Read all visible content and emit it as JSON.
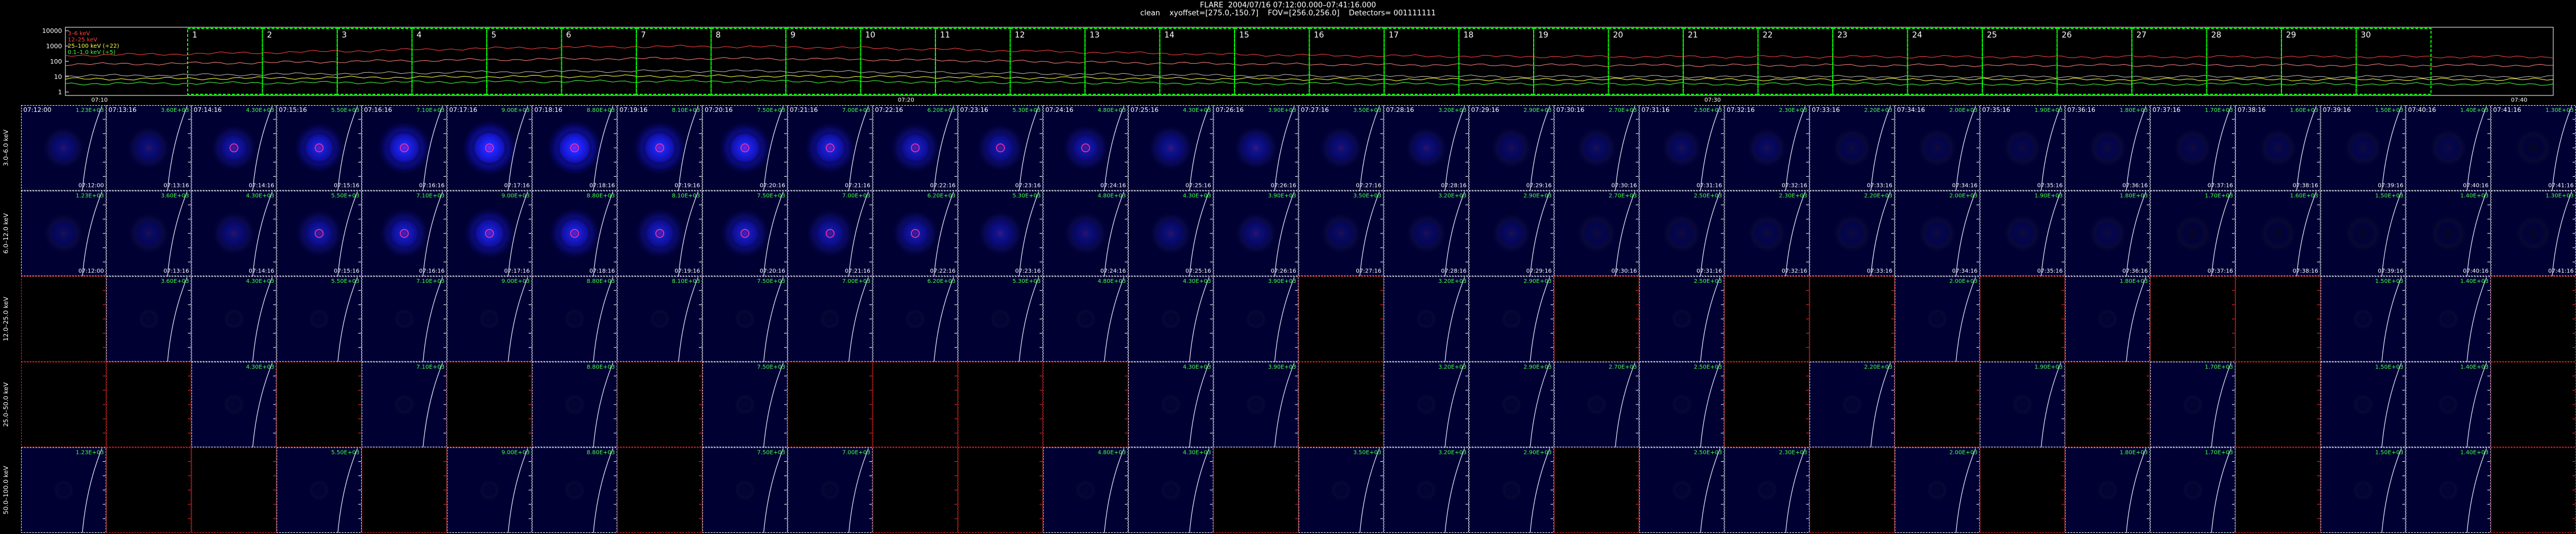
{
  "header": {
    "title": "FLARE  2004/07/16 07:12:00.000–07:41:16.000",
    "subtitle": "clean    xyoffset=[275.0,-150.7]    FOV=[256.0,256.0]    Detectors= 001111111"
  },
  "lightcurve": {
    "legend": [
      "3–6 keV",
      "12–25 keV",
      "25–100 keV (÷22)",
      "0.1–1.0 keV (÷5)"
    ],
    "legend_colors": [
      "#ff4040",
      "#ff4040",
      "#ffff40",
      "#40ff40"
    ],
    "y_ticks": [
      "10000",
      "1000",
      "100",
      "10",
      "1"
    ],
    "time_ticks": [
      "07:10",
      "07:20",
      "07:30",
      "07:40"
    ],
    "interval_labels": [
      "1",
      "2",
      "3",
      "4",
      "5",
      "6",
      "7",
      "8",
      "9",
      "10",
      "11",
      "12",
      "13",
      "14",
      "15",
      "16",
      "17",
      "18",
      "19",
      "20",
      "21",
      "22",
      "23",
      "24",
      "25",
      "26",
      "27",
      "28",
      "29",
      "30"
    ],
    "interval_outline_color": "#00ff00"
  },
  "rows": [
    {
      "band": "3.0–6.0 keV",
      "data": [
        1,
        1,
        1,
        1,
        1,
        1,
        1,
        1,
        1,
        1,
        1,
        1,
        1,
        1,
        1,
        1,
        1,
        1,
        1,
        1,
        1,
        1,
        1,
        1,
        1,
        1,
        1,
        1,
        1,
        1
      ]
    },
    {
      "band": "6.0–12.0 keV",
      "data": [
        1,
        1,
        1,
        1,
        1,
        1,
        1,
        1,
        1,
        1,
        1,
        1,
        1,
        1,
        1,
        1,
        1,
        1,
        1,
        1,
        1,
        1,
        1,
        1,
        1,
        1,
        1,
        1,
        1,
        1
      ]
    },
    {
      "band": "12.0–25.0 keV",
      "data": [
        0,
        1,
        1,
        1,
        1,
        1,
        1,
        1,
        1,
        1,
        1,
        1,
        1,
        1,
        1,
        0,
        1,
        1,
        0,
        1,
        0,
        0,
        1,
        0,
        1,
        0,
        0,
        1,
        1,
        0
      ]
    },
    {
      "band": "25.0–50.0 keV",
      "data": [
        0,
        0,
        1,
        0,
        1,
        0,
        1,
        0,
        1,
        0,
        0,
        0,
        0,
        1,
        1,
        0,
        1,
        1,
        1,
        1,
        0,
        1,
        0,
        1,
        0,
        1,
        0,
        1,
        1,
        0
      ]
    },
    {
      "band": "50.0–100.0 keV",
      "data": [
        1,
        0,
        0,
        1,
        0,
        1,
        1,
        0,
        1,
        1,
        0,
        0,
        1,
        1,
        0,
        1,
        1,
        1,
        0,
        1,
        1,
        0,
        1,
        0,
        1,
        1,
        0,
        1,
        1,
        0
      ]
    }
  ],
  "times": [
    "07:12:00",
    "07:13:16",
    "07:14:16",
    "07:15:16",
    "07:16:16",
    "07:17:16",
    "07:18:16",
    "07:19:16",
    "07:20:16",
    "07:21:16",
    "07:22:16",
    "07:23:16",
    "07:24:16",
    "07:25:16",
    "07:26:16",
    "07:27:16",
    "07:28:16",
    "07:29:16",
    "07:30:16",
    "07:31:16",
    "07:32:16",
    "07:33:16",
    "07:34:16",
    "07:35:16",
    "07:36:16",
    "07:37:16",
    "07:38:16",
    "07:39:16",
    "07:40:16",
    "07:41:16"
  ],
  "intensity": [
    0.35,
    0.4,
    0.55,
    0.75,
    0.9,
    1.0,
    0.98,
    0.92,
    0.85,
    0.8,
    0.72,
    0.62,
    0.55,
    0.5,
    0.45,
    0.4,
    0.36,
    0.33,
    0.3,
    0.28,
    0.26,
    0.24,
    0.22,
    0.2,
    0.19,
    0.18,
    0.17,
    0.16,
    0.15,
    0.14
  ],
  "peak_labels": [
    "1.23E+03",
    "3.60E+03",
    "4.30E+03",
    "5.50E+03",
    "7.10E+03",
    "9.00E+03",
    "8.80E+03",
    "8.10E+03",
    "7.50E+03",
    "7.00E+03",
    "6.20E+03",
    "5.30E+03",
    "4.80E+03",
    "4.30E+03",
    "3.90E+03",
    "3.50E+03",
    "3.20E+03",
    "2.90E+03",
    "2.70E+03",
    "2.50E+03",
    "2.30E+03",
    "2.20E+03",
    "2.00E+03",
    "1.90E+03",
    "1.80E+03",
    "1.70E+03",
    "1.60E+03",
    "1.50E+03",
    "1.40E+03",
    "1.30E+03"
  ],
  "colors": {
    "panel_on": "#000033",
    "panel_off": "#000000",
    "grid_white": "#ffffff",
    "grid_red": "#ff2a2a",
    "label_green": "#40ff40",
    "limb": "#e8e8ff"
  }
}
